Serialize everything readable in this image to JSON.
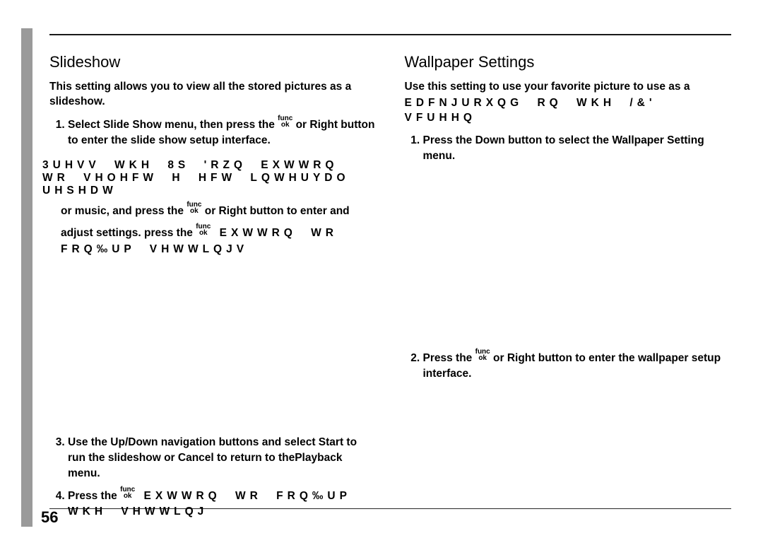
{
  "page_number": "56",
  "left": {
    "heading": "Slideshow",
    "intro": "This setting allows you to view all the stored pictures as a slideshow.",
    "step1_a": "Select Slide Show menu, then press the ",
    "step1_b": " or Right button to enter the slide show setup interface.",
    "garbled_line": "3UHVV WKH 8S 'RZQ EXWWRQ WR VHOHFW H HFW LQWHUYDO UHSHDW",
    "step2_cont_a": "or music, and press the ",
    "step2_cont_b": " or Right button to enter and",
    "step2_cont_c": "adjust settings. press the ",
    "step2_garbled_tail": "EXWWRQ WR FRQ‰UP VHWWLQJV",
    "step3": "Use the Up/Down navigation buttons and select Start to run the slideshow or Cancel to return to thePlayback menu.",
    "step4_a": "Press the ",
    "step4_garbled": "EXWWRQ WR FRQ‰UP WKH VHWWLQJ"
  },
  "right": {
    "heading": "Wallpaper Settings",
    "intro": "Use this setting to use your favorite picture to use as a",
    "intro_garbled": "EDFNJURXQG RQ WKH /&' VFUHHQ",
    "step1": "Press the Down button to select the Wallpaper Setting menu.",
    "step2_a": "Press the ",
    "step2_b": " or Right button to enter the wallpaper setup interface."
  },
  "func_icon": {
    "top": "func",
    "bot": "ok"
  }
}
